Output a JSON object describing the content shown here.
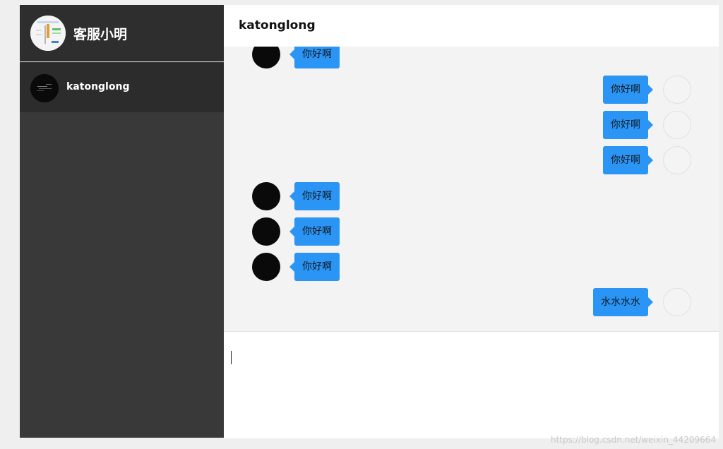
{
  "sidebar": {
    "profile": {
      "name": "客服小明",
      "avatar_icon": "screenshot-thumbnail-avatar"
    },
    "contacts": [
      {
        "name": "katonglong",
        "avatar_icon": "dark-avatar"
      }
    ]
  },
  "chat": {
    "title": "katonglong",
    "messages": [
      {
        "side": "left",
        "text": "你好啊"
      },
      {
        "side": "right",
        "text": "你好啊"
      },
      {
        "side": "right",
        "text": "你好啊"
      },
      {
        "side": "right",
        "text": "你好啊"
      },
      {
        "side": "left",
        "text": "你好啊"
      },
      {
        "side": "left",
        "text": "你好啊"
      },
      {
        "side": "left",
        "text": "你好啊"
      },
      {
        "side": "right",
        "text": "水水水水"
      }
    ],
    "input": {
      "value": ""
    }
  },
  "watermark": "https://blog.csdn.net/weixin_44209664",
  "colors": {
    "sidebar_bg": "#393939",
    "bubble": "#2b95f5",
    "chat_bg": "#f3f3f3"
  }
}
